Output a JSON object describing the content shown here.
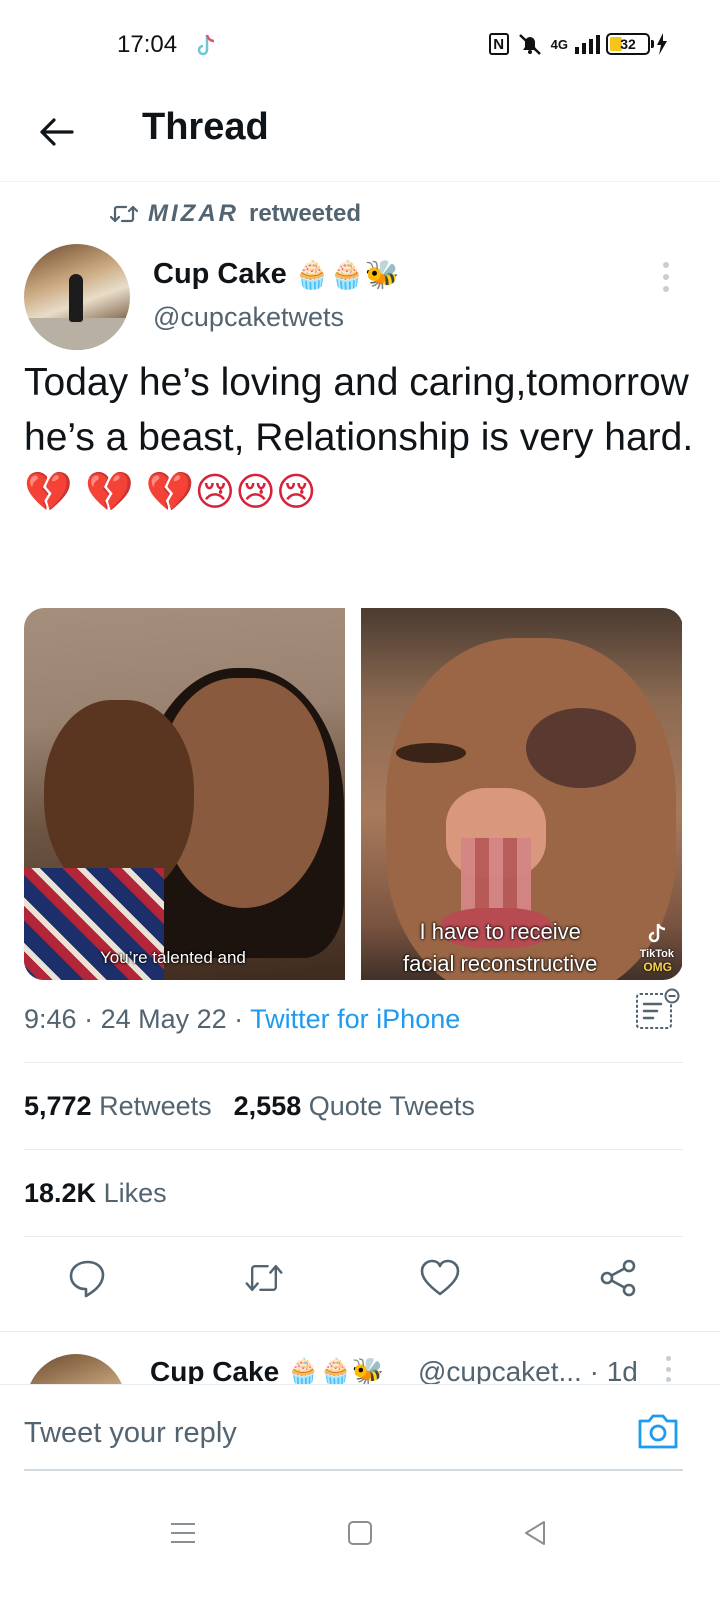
{
  "status_bar": {
    "time": "17:04",
    "network": "4G",
    "battery": "32"
  },
  "header": {
    "title": "Thread"
  },
  "retweet": {
    "name": "MIZAR",
    "suffix": "retweeted"
  },
  "tweet": {
    "author_name": "Cup Cake",
    "author_emojis": "🧁🧁🐝",
    "author_handle": "@cupcaketwets",
    "text": "Today he’s loving and caring,tomorrow he’s a beast, Relationship is very hard.",
    "text_emojis": " 💔 💔 💔😢😢😢",
    "media": [
      {
        "caption": "You’re talented and"
      },
      {
        "caption": "I have to receive\nfacial reconstructive",
        "watermark": "TikTok",
        "tag": "OMG"
      }
    ],
    "time": "9:46",
    "date": "24 May 22",
    "source": "Twitter for iPhone",
    "retweets_count": "5,772",
    "retweets_label": "Retweets",
    "quotes_count": "2,558",
    "quotes_label": "Quote Tweets",
    "likes_count": "18.2K",
    "likes_label": "Likes"
  },
  "reply_preview": {
    "name": "Cup Cake",
    "emojis": "🧁🧁🐝",
    "handle": "@cupcaket... · 1d"
  },
  "compose": {
    "placeholder": "Tweet your reply"
  },
  "colors": {
    "accent": "#1d9bf0",
    "text_primary": "#0f1419",
    "text_secondary": "#536471"
  }
}
